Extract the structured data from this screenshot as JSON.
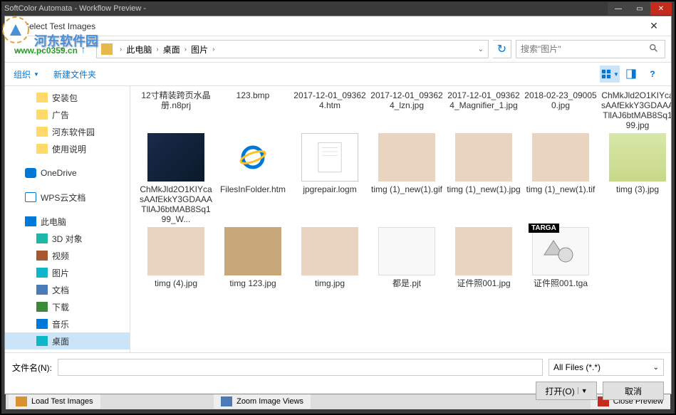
{
  "outer": {
    "title": "SoftColor Automata - Workflow Preview -",
    "btn_min": "—",
    "btn_max": "▭",
    "btn_close": "✕"
  },
  "watermark": {
    "cn": "河东软件园",
    "url": "www.pc0359.cn"
  },
  "dialog": {
    "title": "Select Test Images",
    "close": "✕"
  },
  "nav": {
    "back": "←",
    "fwd": "→",
    "recent": "▾",
    "up": "↑",
    "refresh": "↻"
  },
  "breadcrumb": {
    "root_sep": "›",
    "items": [
      "此电脑",
      "桌面",
      "图片"
    ]
  },
  "search": {
    "placeholder": "搜索\"图片\""
  },
  "toolbar": {
    "organize": "组织",
    "newfolder": "新建文件夹"
  },
  "sidebar": {
    "items": [
      {
        "label": "安装包",
        "cls": "folder-icon",
        "ind": "indent2"
      },
      {
        "label": "广告",
        "cls": "folder-icon",
        "ind": "indent2"
      },
      {
        "label": "河东软件园",
        "cls": "folder-icon",
        "ind": "indent2"
      },
      {
        "label": "使用说明",
        "cls": "folder-icon",
        "ind": "indent2"
      },
      {
        "label": "",
        "cls": "",
        "ind": ""
      },
      {
        "label": "OneDrive",
        "cls": "onedrive-icon",
        "ind": ""
      },
      {
        "label": "",
        "cls": "",
        "ind": ""
      },
      {
        "label": "WPS云文档",
        "cls": "wps-icon",
        "ind": ""
      },
      {
        "label": "",
        "cls": "",
        "ind": ""
      },
      {
        "label": "此电脑",
        "cls": "pc-icon",
        "ind": ""
      },
      {
        "label": "3D 对象",
        "cls": "obj3d-icon",
        "ind": "indent2"
      },
      {
        "label": "视频",
        "cls": "video-icon",
        "ind": "indent2"
      },
      {
        "label": "图片",
        "cls": "pic-icon",
        "ind": "indent2"
      },
      {
        "label": "文档",
        "cls": "doc-icon",
        "ind": "indent2"
      },
      {
        "label": "下载",
        "cls": "dl-icon",
        "ind": "indent2"
      },
      {
        "label": "音乐",
        "cls": "music-icon",
        "ind": "indent2"
      },
      {
        "label": "桌面",
        "cls": "desk-icon",
        "ind": "indent2",
        "sel": true
      }
    ]
  },
  "files": {
    "row0": [
      "12寸精装跨页水晶册.n8prj",
      "123.bmp",
      "2017-12-01_093624.htm",
      "2017-12-01_093624_lzn.jpg",
      "2017-12-01_093624_Magnifier_1.jpg",
      "2018-02-23_090050.jpg",
      "ChMkJld2O1KIYcasAAfEkkY3GDAAATllAJ6btMAB8Sq199.jpg"
    ],
    "row1": [
      {
        "name": "ChMkJld2O1KIYcasAAfEkkY3GDAAATllAJ6btMAB8Sq199_W...",
        "thumb": "img1"
      },
      {
        "name": "FilesInFolder.htm",
        "thumb": "ie"
      },
      {
        "name": "jpgrepair.logm",
        "thumb": "txt"
      },
      {
        "name": "timg (1)_new(1).gif",
        "thumb": "girl"
      },
      {
        "name": "timg (1)_new(1).jpg",
        "thumb": "girl"
      },
      {
        "name": "timg (1)_new(1).tif",
        "thumb": "girl"
      },
      {
        "name": "timg (3).jpg",
        "thumb": "girl2"
      }
    ],
    "row2": [
      {
        "name": "timg (4).jpg",
        "thumb": "girl"
      },
      {
        "name": "timg 123.jpg",
        "thumb": "collage"
      },
      {
        "name": "timg.jpg",
        "thumb": "girl"
      },
      {
        "name": "都是.pjt",
        "thumb": "white"
      },
      {
        "name": "证件照001.jpg",
        "thumb": "girl"
      },
      {
        "name": "证件照001.tga",
        "thumb": "targa",
        "tag": "TARGA"
      }
    ]
  },
  "bottom": {
    "fn_label": "文件名(N):",
    "filter": "All Files (*.*)",
    "open": "打开(O)",
    "cancel": "取消"
  },
  "status": {
    "load": "Load Test Images",
    "zoom": "Zoom Image Views",
    "closep": "Close Preview"
  }
}
